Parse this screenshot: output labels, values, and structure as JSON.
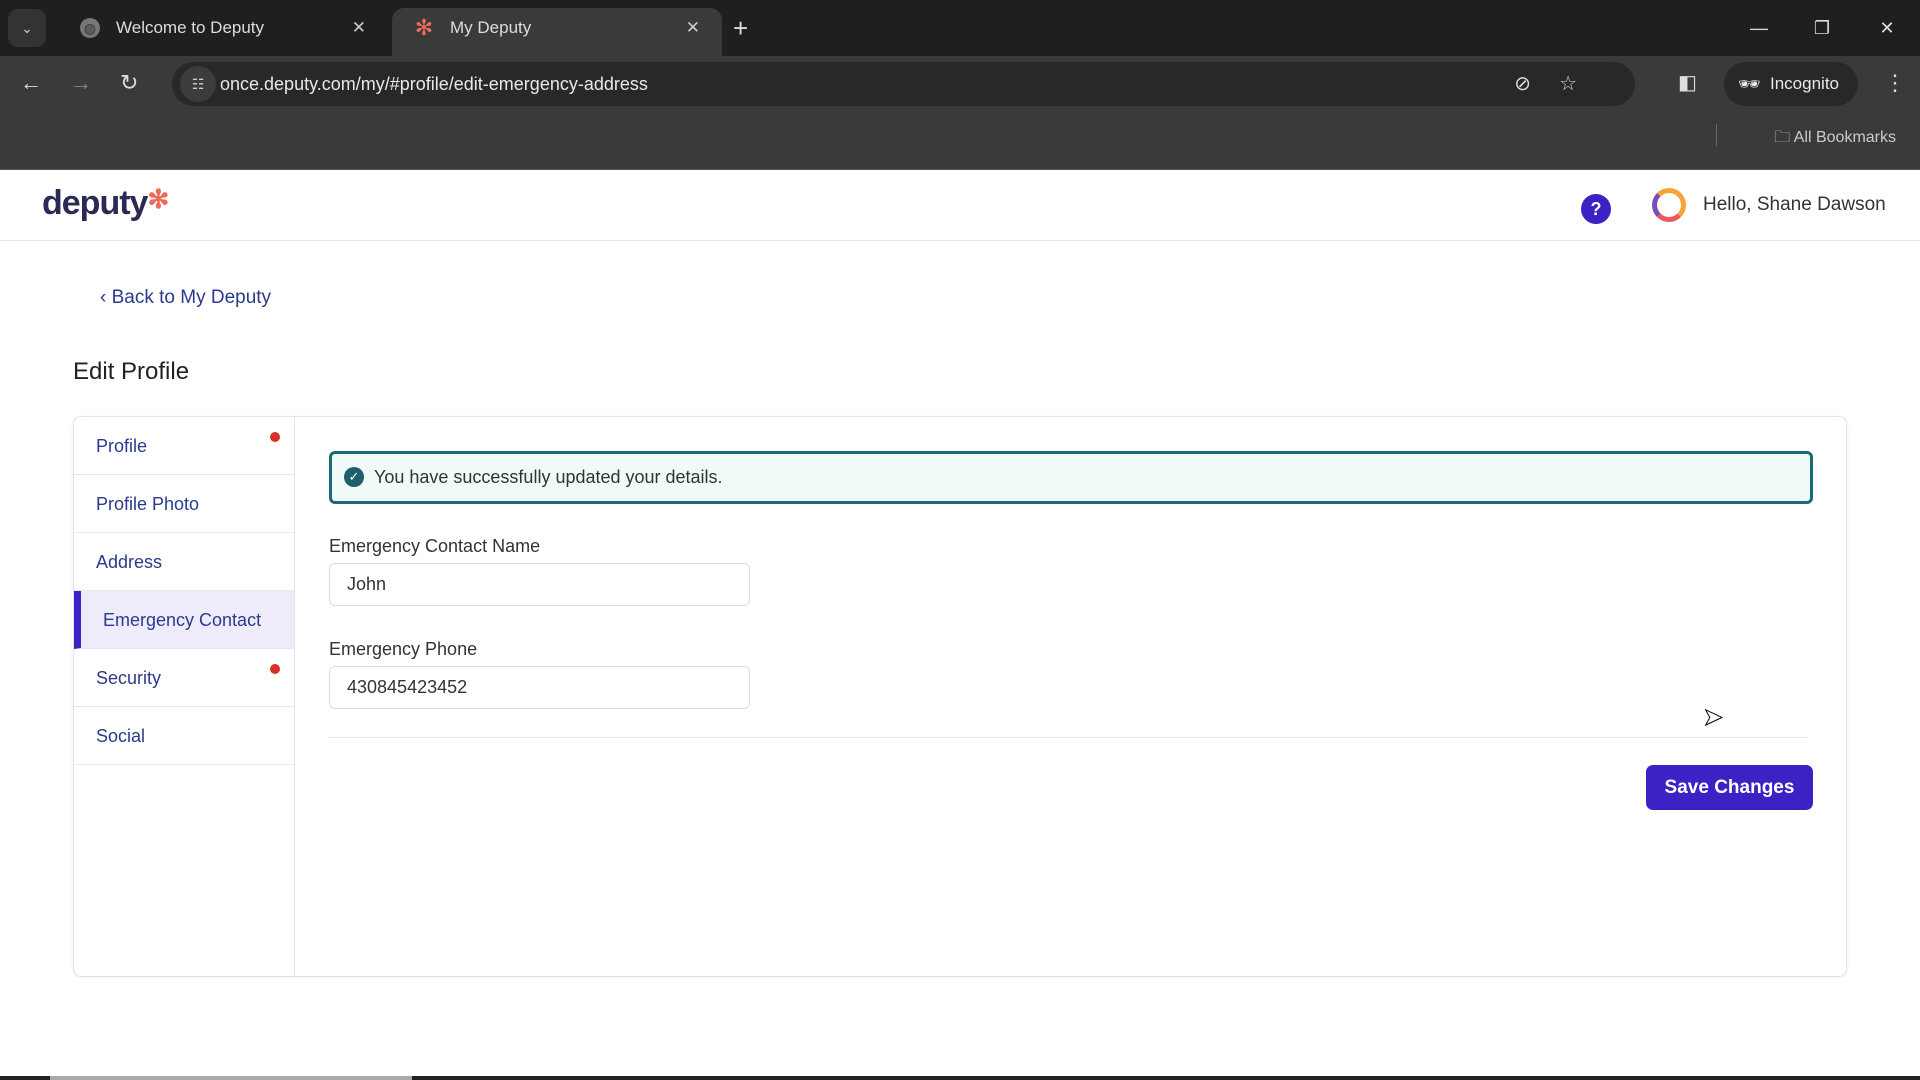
{
  "browser": {
    "tabs": [
      {
        "title": "Welcome to Deputy",
        "active": false
      },
      {
        "title": "My Deputy",
        "active": true
      }
    ],
    "url": "once.deputy.com/my/#profile/edit-emergency-address",
    "incognito_label": "Incognito",
    "bookmarks_label": "All Bookmarks"
  },
  "header": {
    "logo": "deputy",
    "help": "?",
    "greeting": "Hello, Shane Dawson"
  },
  "back_link": "Back to My Deputy",
  "page_title": "Edit Profile",
  "sidebar": {
    "items": [
      {
        "label": "Profile",
        "alert": true
      },
      {
        "label": "Profile Photo",
        "alert": false
      },
      {
        "label": "Address",
        "alert": false
      },
      {
        "label": "Emergency Contact",
        "alert": false,
        "active": true
      },
      {
        "label": "Security",
        "alert": true
      },
      {
        "label": "Social",
        "alert": false
      }
    ]
  },
  "alert": {
    "message": "You have successfully updated your details."
  },
  "form": {
    "contact_name_label": "Emergency Contact Name",
    "contact_name_value": "John",
    "phone_label": "Emergency Phone",
    "phone_value": "430845423452"
  },
  "save_label": "Save Changes",
  "colors": {
    "accent": "#3a22c4",
    "success_border": "#1d6b72",
    "alert_dot": "#d9302a"
  }
}
